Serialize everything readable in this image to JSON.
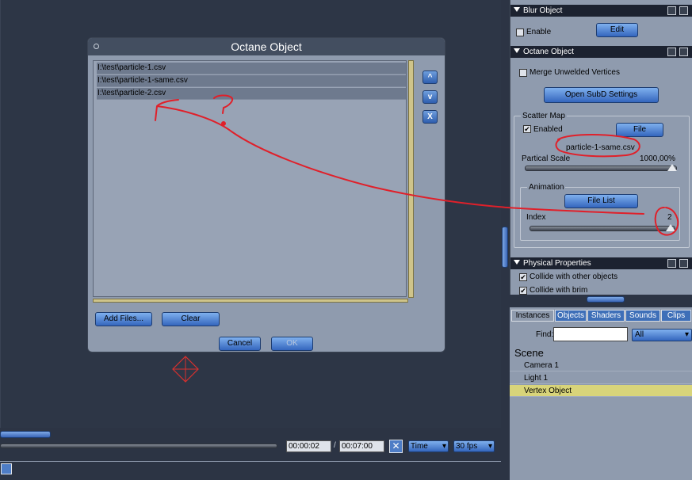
{
  "dialog": {
    "title": "Octane Object",
    "files": [
      "I:\\test\\particle-1.csv",
      "I:\\test\\particle-1-same.csv",
      "I:\\test\\particle-2.csv"
    ],
    "move_up_label": "^",
    "move_down_label": "v",
    "remove_label": "X",
    "add_files_label": "Add Files...",
    "clear_label": "Clear",
    "cancel_label": "Cancel",
    "ok_label": "OK"
  },
  "panel": {
    "blur_object": {
      "header": "Blur Object",
      "enabled_label": "Enable",
      "edit_label": "Edit"
    },
    "octane_object": {
      "header": "Octane Object",
      "merge_label": "Merge Unwelded Vertices",
      "open_subd_label": "Open SubD Settings",
      "scatter_map_label": "Scatter Map",
      "enabled_label": "Enabled",
      "file_label": "File",
      "file_name": "particle-1-same.csv",
      "partical_scale_label": "Partical Scale",
      "partical_scale_value": "1000,00%",
      "animation_label": "Animation",
      "file_list_label": "File List",
      "index_label": "Index",
      "index_value": "2"
    },
    "physical_properties": {
      "header": "Physical Properties",
      "collide_label": "Collide with other objects",
      "collide_brim_label": "Collide with brim"
    }
  },
  "library": {
    "tabs": [
      "Instances",
      "Objects",
      "Shaders",
      "Sounds",
      "Clips"
    ],
    "find_label": "Find:",
    "find_value": "",
    "filter_value": "All",
    "scene_label": "Scene",
    "scene_items": [
      "Camera 1",
      "Light 1",
      "Vertex Object"
    ]
  },
  "timeline": {
    "current_time": "00:00:02",
    "separator": "/",
    "total_time": "00:07:00",
    "mode": "Time",
    "fps": "30 fps"
  },
  "colors": {
    "selected_row": "#d8d47a",
    "annotation_red": "#e0202a"
  }
}
